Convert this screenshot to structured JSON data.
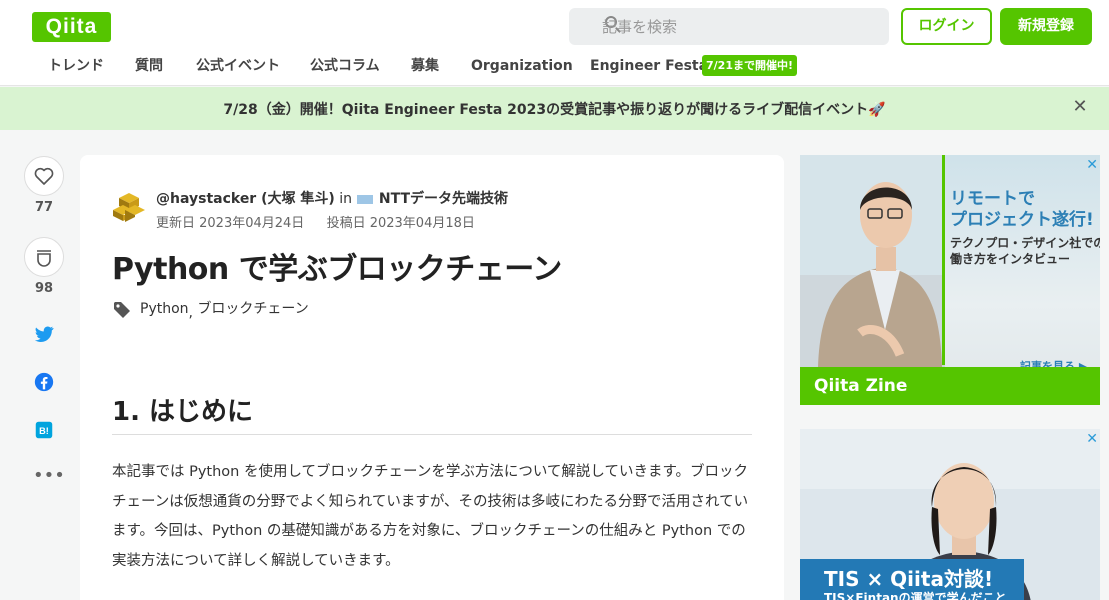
{
  "brand": {
    "logo": "Qiita",
    "green": "#55c500"
  },
  "header": {
    "search_placeholder": "記事を検索",
    "login_label": "ログイン",
    "signup_label": "新規登録"
  },
  "nav": {
    "items": [
      "トレンド",
      "質問",
      "公式イベント",
      "公式コラム",
      "募集",
      "Organization",
      "Engineer Festa"
    ],
    "badge": "7/21まで開催中!"
  },
  "banner": {
    "text": "7/28（金）開催！Qiita Engineer Festa 2023の受賞記事や振り返りが聞けるライブ配信イベント🚀"
  },
  "sidebar": {
    "likes": "77",
    "stocks": "98"
  },
  "article": {
    "author": "@haystacker (大塚 隼斗)",
    "in_label": "in",
    "org": "NTTデータ先端技術",
    "updated": "更新日 2023年04月24日",
    "posted": "投稿日 2023年04月18日",
    "title": "Python で学ぶブロックチェーン",
    "tags": [
      "Python",
      "ブロックチェーン"
    ],
    "h2": "1. はじめに",
    "body": "本記事では Python を使用してブロックチェーンを学ぶ方法について解説していきます。ブロックチェーンは仮想通貨の分野でよく知られていますが、その技術は多岐にわたる分野で活用されています。今回は、Python の基礎知識がある方を対象に、ブロックチェーンの仕組みと Python での実装方法について詳しく解説していきます。"
  },
  "ads": {
    "ad1": {
      "title1": "リモートで",
      "title2": "プロジェクト遂行!",
      "sub1": "テクノプロ・デザイン社での",
      "sub2": "働き方をインタビュー",
      "more": "記事を見る ▶",
      "footer": "Qiita Zine"
    },
    "ad2": {
      "title": "TIS × Qiita対談!",
      "sub": "TIS×Fintanの運営で学んだこと"
    }
  }
}
